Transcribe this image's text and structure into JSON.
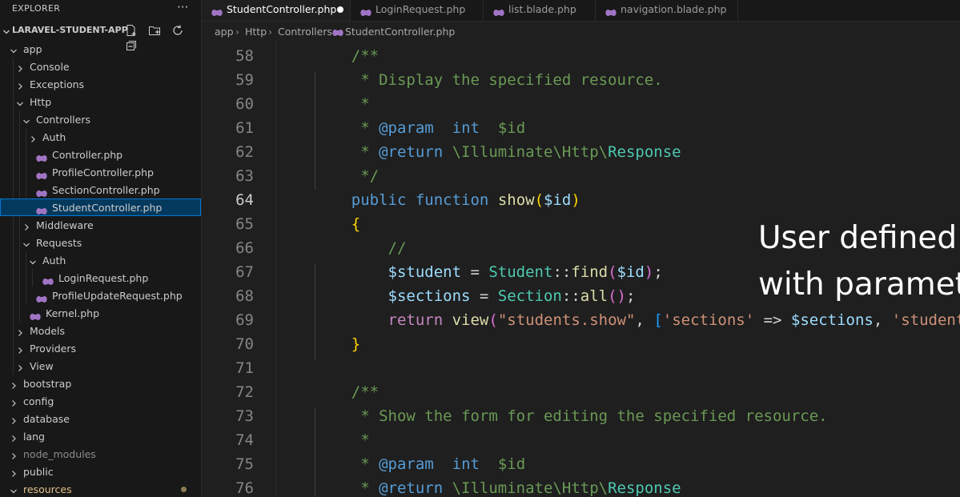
{
  "explorer": {
    "title": "EXPLORER",
    "more_label": "···",
    "project_name": "LARAVEL-STUDENT-APP",
    "actions": [
      "new-file-icon",
      "new-folder-icon",
      "refresh-icon",
      "collapse-all-icon"
    ],
    "tree": [
      {
        "label": "app",
        "depth": 0,
        "kind": "folder",
        "open": true
      },
      {
        "label": "Console",
        "depth": 1,
        "kind": "folder",
        "open": false
      },
      {
        "label": "Exceptions",
        "depth": 1,
        "kind": "folder",
        "open": false
      },
      {
        "label": "Http",
        "depth": 1,
        "kind": "folder",
        "open": true
      },
      {
        "label": "Controllers",
        "depth": 2,
        "kind": "folder",
        "open": true
      },
      {
        "label": "Auth",
        "depth": 3,
        "kind": "folder",
        "open": false
      },
      {
        "label": "Controller.php",
        "depth": 3,
        "kind": "php"
      },
      {
        "label": "ProfileController.php",
        "depth": 3,
        "kind": "php"
      },
      {
        "label": "SectionController.php",
        "depth": 3,
        "kind": "php"
      },
      {
        "label": "StudentController.php",
        "depth": 3,
        "kind": "php",
        "selected": true
      },
      {
        "label": "Middleware",
        "depth": 2,
        "kind": "folder",
        "open": false
      },
      {
        "label": "Requests",
        "depth": 2,
        "kind": "folder",
        "open": true
      },
      {
        "label": "Auth",
        "depth": 3,
        "kind": "folder",
        "open": true
      },
      {
        "label": "LoginRequest.php",
        "depth": 4,
        "kind": "php"
      },
      {
        "label": "ProfileUpdateRequest.php",
        "depth": 3,
        "kind": "php"
      },
      {
        "label": "Kernel.php",
        "depth": 2,
        "kind": "php"
      },
      {
        "label": "Models",
        "depth": 1,
        "kind": "folder",
        "open": false
      },
      {
        "label": "Providers",
        "depth": 1,
        "kind": "folder",
        "open": false
      },
      {
        "label": "View",
        "depth": 1,
        "kind": "folder",
        "open": false
      },
      {
        "label": "bootstrap",
        "depth": 0,
        "kind": "folder",
        "open": false
      },
      {
        "label": "config",
        "depth": 0,
        "kind": "folder",
        "open": false
      },
      {
        "label": "database",
        "depth": 0,
        "kind": "folder",
        "open": false
      },
      {
        "label": "lang",
        "depth": 0,
        "kind": "folder",
        "open": false
      },
      {
        "label": "node_modules",
        "depth": 0,
        "kind": "folder",
        "open": false,
        "dim": true
      },
      {
        "label": "public",
        "depth": 0,
        "kind": "folder",
        "open": false
      },
      {
        "label": "resources",
        "depth": 0,
        "kind": "folder",
        "open": true,
        "modified": true
      }
    ]
  },
  "tabs": [
    {
      "label": "StudentController.php",
      "active": true,
      "dirty": true,
      "icon": "php-icon"
    },
    {
      "label": "LoginRequest.php",
      "active": false,
      "icon": "php-icon"
    },
    {
      "label": "list.blade.php",
      "active": false,
      "icon": "php-icon"
    },
    {
      "label": "navigation.blade.php",
      "active": false,
      "icon": "php-icon"
    }
  ],
  "breadcrumb": [
    "app",
    "Http",
    "Controllers",
    "StudentController.php"
  ],
  "breadcrumb_separator": "›",
  "editor": {
    "current_line": "64",
    "lines": [
      {
        "num": "58",
        "tokens": [
          [
            "",
            "    "
          ],
          [
            "c-cm",
            "/**"
          ]
        ]
      },
      {
        "num": "59",
        "tokens": [
          [
            "",
            "     "
          ],
          [
            "c-cm",
            "* Display the specified resource."
          ]
        ]
      },
      {
        "num": "60",
        "tokens": [
          [
            "",
            "     "
          ],
          [
            "c-cm",
            "*"
          ]
        ]
      },
      {
        "num": "61",
        "tokens": [
          [
            "",
            "     "
          ],
          [
            "c-cm",
            "* "
          ],
          [
            "c-cmkw",
            "@param"
          ],
          [
            "c-cm",
            "  "
          ],
          [
            "c-cmkw",
            "int"
          ],
          [
            "c-cm",
            "  $id"
          ]
        ]
      },
      {
        "num": "62",
        "tokens": [
          [
            "",
            "     "
          ],
          [
            "c-cm",
            "* "
          ],
          [
            "c-cmkw",
            "@return"
          ],
          [
            "c-cm",
            " \\Illuminate\\Http\\"
          ],
          [
            "c-cls",
            "Response"
          ]
        ]
      },
      {
        "num": "63",
        "tokens": [
          [
            "",
            "     "
          ],
          [
            "c-cm",
            "*/"
          ]
        ]
      },
      {
        "num": "64",
        "tokens": [
          [
            "",
            "    "
          ],
          [
            "c-kw",
            "public"
          ],
          [
            "c-pun",
            " "
          ],
          [
            "c-kw",
            "function"
          ],
          [
            "c-pun",
            " "
          ],
          [
            "c-fn",
            "show"
          ],
          [
            "c-br1",
            "("
          ],
          [
            "c-var",
            "$id"
          ],
          [
            "c-br1",
            ")"
          ]
        ]
      },
      {
        "num": "65",
        "tokens": [
          [
            "",
            "    "
          ],
          [
            "c-br1",
            "{"
          ]
        ]
      },
      {
        "num": "66",
        "tokens": [
          [
            "",
            "        "
          ],
          [
            "c-cm",
            "//"
          ]
        ]
      },
      {
        "num": "67",
        "tokens": [
          [
            "",
            "        "
          ],
          [
            "c-var",
            "$student"
          ],
          [
            "c-pun",
            " = "
          ],
          [
            "c-cls",
            "Student"
          ],
          [
            "c-pun",
            "::"
          ],
          [
            "c-fn",
            "find"
          ],
          [
            "c-br2",
            "("
          ],
          [
            "c-var",
            "$id"
          ],
          [
            "c-br2",
            ")"
          ],
          [
            "c-pun",
            ";"
          ]
        ]
      },
      {
        "num": "68",
        "tokens": [
          [
            "",
            "        "
          ],
          [
            "c-var",
            "$sections"
          ],
          [
            "c-pun",
            " = "
          ],
          [
            "c-cls",
            "Section"
          ],
          [
            "c-pun",
            "::"
          ],
          [
            "c-fn",
            "all"
          ],
          [
            "c-br2",
            "()"
          ],
          [
            "c-pun",
            ";"
          ]
        ]
      },
      {
        "num": "69",
        "tokens": [
          [
            "",
            "        "
          ],
          [
            "c-ctrl",
            "return"
          ],
          [
            "c-pun",
            " "
          ],
          [
            "c-fn",
            "view"
          ],
          [
            "c-br2",
            "("
          ],
          [
            "c-str",
            "\"students.show\""
          ],
          [
            "c-pun",
            ", "
          ],
          [
            "c-br3",
            "["
          ],
          [
            "c-str",
            "'sections'"
          ],
          [
            "c-pun",
            " => "
          ],
          [
            "c-var",
            "$sections"
          ],
          [
            "c-pun",
            ", "
          ],
          [
            "c-str",
            "'student"
          ]
        ]
      },
      {
        "num": "70",
        "tokens": [
          [
            "",
            "    "
          ],
          [
            "c-br1",
            "}"
          ]
        ]
      },
      {
        "num": "71",
        "tokens": []
      },
      {
        "num": "72",
        "tokens": [
          [
            "",
            "    "
          ],
          [
            "c-cm",
            "/**"
          ]
        ]
      },
      {
        "num": "73",
        "tokens": [
          [
            "",
            "     "
          ],
          [
            "c-cm",
            "* Show the form for editing the specified resource."
          ]
        ]
      },
      {
        "num": "74",
        "tokens": [
          [
            "",
            "     "
          ],
          [
            "c-cm",
            "*"
          ]
        ]
      },
      {
        "num": "75",
        "tokens": [
          [
            "",
            "     "
          ],
          [
            "c-cm",
            "* "
          ],
          [
            "c-cmkw",
            "@param"
          ],
          [
            "c-cm",
            "  "
          ],
          [
            "c-cmkw",
            "int"
          ],
          [
            "c-cm",
            "  $id"
          ]
        ]
      },
      {
        "num": "76",
        "tokens": [
          [
            "",
            "     "
          ],
          [
            "c-cm",
            "* "
          ],
          [
            "c-cmkw",
            "@return"
          ],
          [
            "c-cm",
            " \\Illuminate\\Http\\"
          ],
          [
            "c-cls",
            "Response"
          ]
        ]
      }
    ]
  },
  "overlay": {
    "line1": "User defined methods",
    "line2": "with parameters"
  },
  "colors": {
    "php_icon": "#a074c4",
    "selection": "#04395e",
    "accent": "#0078d4"
  }
}
